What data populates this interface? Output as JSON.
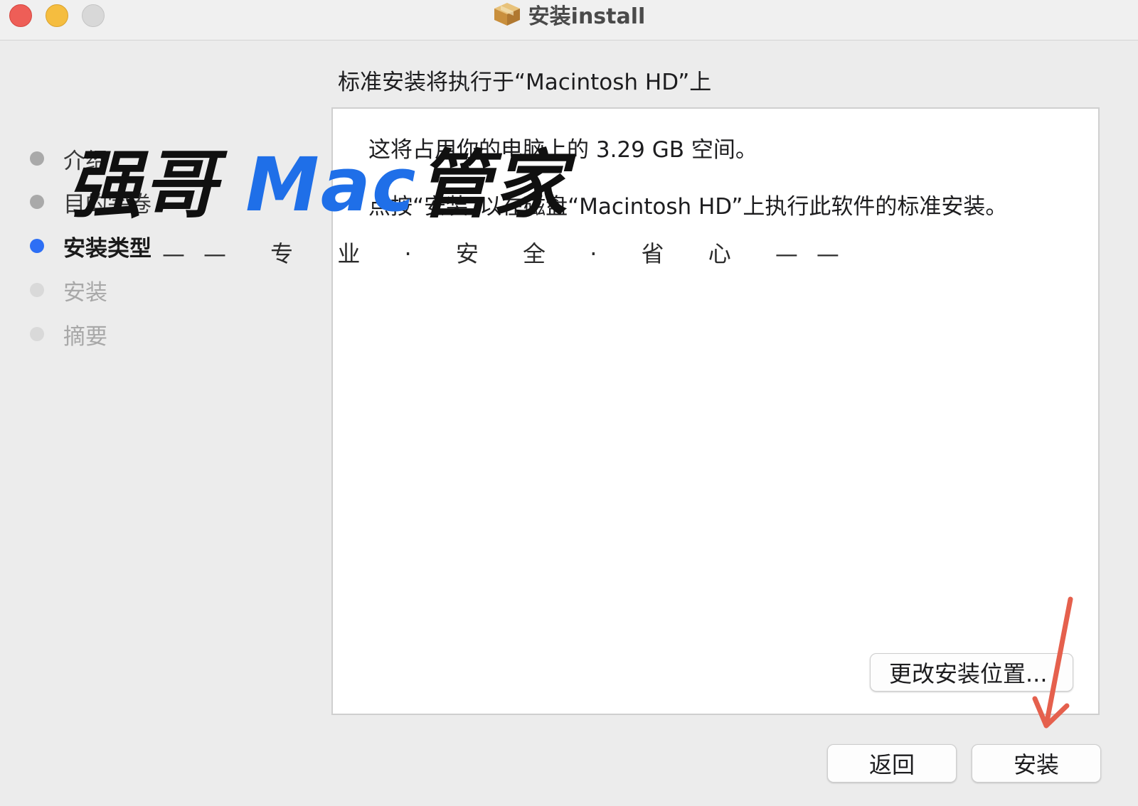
{
  "window": {
    "title": "安装install",
    "title_icon": "package-icon"
  },
  "sidebar": {
    "steps": [
      {
        "label": "介绍",
        "state": "done"
      },
      {
        "label": "目的宗卷",
        "state": "done"
      },
      {
        "label": "安装类型",
        "state": "current"
      },
      {
        "label": "安装",
        "state": "todo"
      },
      {
        "label": "摘要",
        "state": "todo"
      }
    ]
  },
  "main": {
    "heading": "标准安装将执行于“Macintosh HD”上",
    "space_text": "这将占用你的电脑上的 3.29 GB 空间。",
    "instruction_text": "点按“安装”以在磁盘“Macintosh HD”上执行此软件的标准安装。",
    "change_location_label": "更改安装位置..."
  },
  "footer": {
    "back_label": "返回",
    "install_label": "安装"
  },
  "watermark": {
    "brand_part1": "强哥",
    "brand_part2": "Mac",
    "brand_part3": "管家",
    "slogan": "—— 专 业 · 安 全 · 省 心 ——"
  },
  "colors": {
    "current_step": "#2d6ff5",
    "close": "#ee5e57",
    "minimize": "#f5bd3f",
    "annotation_arrow": "#e5604d"
  }
}
